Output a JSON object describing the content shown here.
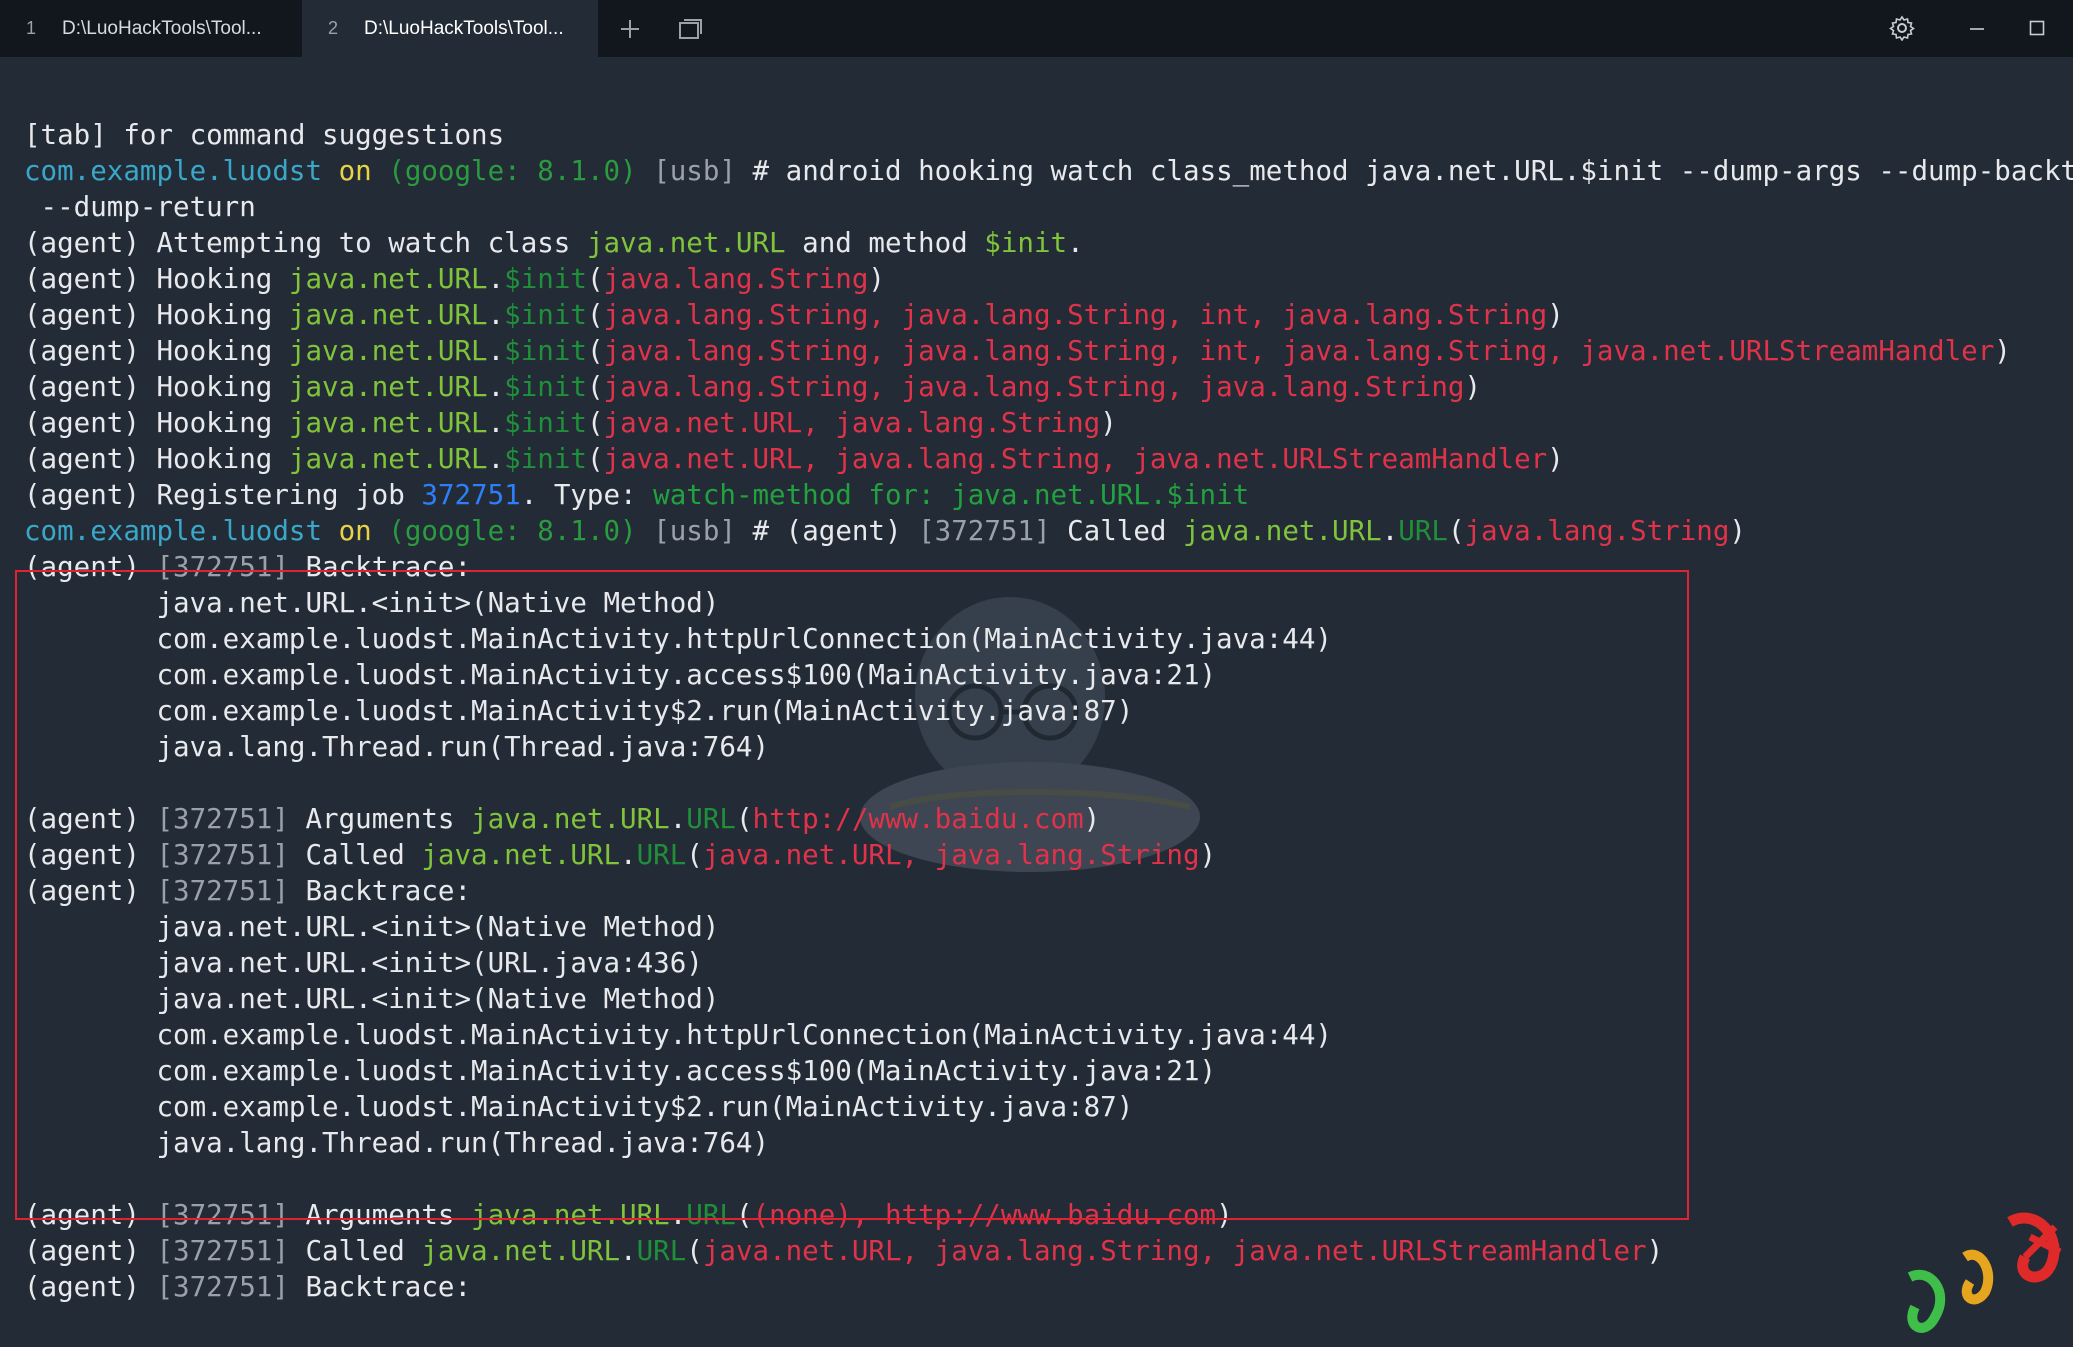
{
  "tabs": [
    {
      "num": "1",
      "title": "D:\\LuoHackTools\\Tool..."
    },
    {
      "num": "2",
      "title": "D:\\LuoHackTools\\Tool..."
    }
  ],
  "icons": {
    "new_tab": "plus-icon",
    "tab_overview": "tabs-icon",
    "settings": "gear-icon",
    "minimize": "minimize-icon",
    "maximize": "maximize-icon"
  },
  "colors": {
    "host": "#3aa7c9",
    "class": "#7fc43a",
    "method": "#1f8f3a",
    "args": "#e0334a",
    "job_id": "#2d7ff9",
    "highlight_border": "#e02232"
  },
  "terminal": {
    "lines": [
      [
        {
          "t": "[tab] for command suggestions"
        }
      ],
      [
        {
          "t": "com.example.luodst",
          "c": "host"
        },
        {
          "t": " "
        },
        {
          "t": "on",
          "c": "on"
        },
        {
          "t": " "
        },
        {
          "t": "(google: 8.1.0)",
          "c": "dev"
        },
        {
          "t": " "
        },
        {
          "t": "[usb]",
          "c": "usb"
        },
        {
          "t": " # android hooking watch class_method java.net.URL.$init --dump-args --dump-backtrace"
        }
      ],
      [
        {
          "t": " --dump-return"
        }
      ],
      [
        {
          "t": "(agent) Attempting to watch class "
        },
        {
          "t": "java.net.URL",
          "c": "cls"
        },
        {
          "t": " and method "
        },
        {
          "t": "$init",
          "c": "cls"
        },
        {
          "t": "."
        }
      ],
      [
        {
          "t": "(agent) Hooking "
        },
        {
          "t": "java.net.URL",
          "c": "cls"
        },
        {
          "t": "."
        },
        {
          "t": "$init",
          "c": "meth"
        },
        {
          "t": "("
        },
        {
          "t": "java.lang.String",
          "c": "arg"
        },
        {
          "t": ")"
        }
      ],
      [
        {
          "t": "(agent) Hooking "
        },
        {
          "t": "java.net.URL",
          "c": "cls"
        },
        {
          "t": "."
        },
        {
          "t": "$init",
          "c": "meth"
        },
        {
          "t": "("
        },
        {
          "t": "java.lang.String, java.lang.String, int, java.lang.String",
          "c": "arg"
        },
        {
          "t": ")"
        }
      ],
      [
        {
          "t": "(agent) Hooking "
        },
        {
          "t": "java.net.URL",
          "c": "cls"
        },
        {
          "t": "."
        },
        {
          "t": "$init",
          "c": "meth"
        },
        {
          "t": "("
        },
        {
          "t": "java.lang.String, java.lang.String, int, java.lang.String, java.net.URLStreamHandler",
          "c": "arg"
        },
        {
          "t": ")"
        }
      ],
      [
        {
          "t": "(agent) Hooking "
        },
        {
          "t": "java.net.URL",
          "c": "cls"
        },
        {
          "t": "."
        },
        {
          "t": "$init",
          "c": "meth"
        },
        {
          "t": "("
        },
        {
          "t": "java.lang.String, java.lang.String, java.lang.String",
          "c": "arg"
        },
        {
          "t": ")"
        }
      ],
      [
        {
          "t": "(agent) Hooking "
        },
        {
          "t": "java.net.URL",
          "c": "cls"
        },
        {
          "t": "."
        },
        {
          "t": "$init",
          "c": "meth"
        },
        {
          "t": "("
        },
        {
          "t": "java.net.URL, java.lang.String",
          "c": "arg"
        },
        {
          "t": ")"
        }
      ],
      [
        {
          "t": "(agent) Hooking "
        },
        {
          "t": "java.net.URL",
          "c": "cls"
        },
        {
          "t": "."
        },
        {
          "t": "$init",
          "c": "meth"
        },
        {
          "t": "("
        },
        {
          "t": "java.net.URL, java.lang.String, java.net.URLStreamHandler",
          "c": "arg"
        },
        {
          "t": ")"
        }
      ],
      [
        {
          "t": "(agent) Registering job "
        },
        {
          "t": "372751",
          "c": "id"
        },
        {
          "t": ". Type: "
        },
        {
          "t": "watch-method for: java.net.URL.$init",
          "c": "watch"
        }
      ],
      [
        {
          "t": "com.example.luodst",
          "c": "host"
        },
        {
          "t": " "
        },
        {
          "t": "on",
          "c": "on"
        },
        {
          "t": " "
        },
        {
          "t": "(google: 8.1.0)",
          "c": "dev"
        },
        {
          "t": " "
        },
        {
          "t": "[usb]",
          "c": "usb"
        },
        {
          "t": " # (agent) "
        },
        {
          "t": "[372751]",
          "c": "job"
        },
        {
          "t": " Called "
        },
        {
          "t": "java.net.URL",
          "c": "cls"
        },
        {
          "t": "."
        },
        {
          "t": "URL",
          "c": "meth"
        },
        {
          "t": "("
        },
        {
          "t": "java.lang.String",
          "c": "arg"
        },
        {
          "t": ")"
        }
      ],
      [
        {
          "t": "(agent) "
        },
        {
          "t": "[372751]",
          "c": "job"
        },
        {
          "t": " Backtrace:"
        }
      ],
      [
        {
          "t": "        java.net.URL.<init>(Native Method)"
        }
      ],
      [
        {
          "t": "        com.example.luodst.MainActivity.httpUrlConnection(MainActivity.java:44)"
        }
      ],
      [
        {
          "t": "        com.example.luodst.MainActivity.access$100(MainActivity.java:21)"
        }
      ],
      [
        {
          "t": "        com.example.luodst.MainActivity$2.run(MainActivity.java:87)"
        }
      ],
      [
        {
          "t": "        java.lang.Thread.run(Thread.java:764)"
        }
      ],
      [
        {
          "t": ""
        }
      ],
      [
        {
          "t": "(agent) "
        },
        {
          "t": "[372751]",
          "c": "job"
        },
        {
          "t": " Arguments "
        },
        {
          "t": "java.net.URL",
          "c": "cls"
        },
        {
          "t": "."
        },
        {
          "t": "URL",
          "c": "meth"
        },
        {
          "t": "("
        },
        {
          "t": "http://www.baidu.com",
          "c": "arg"
        },
        {
          "t": ")"
        }
      ],
      [
        {
          "t": "(agent) "
        },
        {
          "t": "[372751]",
          "c": "job"
        },
        {
          "t": " Called "
        },
        {
          "t": "java.net.URL",
          "c": "cls"
        },
        {
          "t": "."
        },
        {
          "t": "URL",
          "c": "meth"
        },
        {
          "t": "("
        },
        {
          "t": "java.net.URL, java.lang.String",
          "c": "arg"
        },
        {
          "t": ")"
        }
      ],
      [
        {
          "t": "(agent) "
        },
        {
          "t": "[372751]",
          "c": "job"
        },
        {
          "t": " Backtrace:"
        }
      ],
      [
        {
          "t": "        java.net.URL.<init>(Native Method)"
        }
      ],
      [
        {
          "t": "        java.net.URL.<init>(URL.java:436)"
        }
      ],
      [
        {
          "t": "        java.net.URL.<init>(Native Method)"
        }
      ],
      [
        {
          "t": "        com.example.luodst.MainActivity.httpUrlConnection(MainActivity.java:44)"
        }
      ],
      [
        {
          "t": "        com.example.luodst.MainActivity.access$100(MainActivity.java:21)"
        }
      ],
      [
        {
          "t": "        com.example.luodst.MainActivity$2.run(MainActivity.java:87)"
        }
      ],
      [
        {
          "t": "        java.lang.Thread.run(Thread.java:764)"
        }
      ],
      [
        {
          "t": ""
        }
      ],
      [
        {
          "t": "(agent) "
        },
        {
          "t": "[372751]",
          "c": "job"
        },
        {
          "t": " Arguments "
        },
        {
          "t": "java.net.URL",
          "c": "cls"
        },
        {
          "t": "."
        },
        {
          "t": "URL",
          "c": "meth"
        },
        {
          "t": "("
        },
        {
          "t": "(none), http://www.baidu.com",
          "c": "arg"
        },
        {
          "t": ")"
        }
      ],
      [
        {
          "t": "(agent) "
        },
        {
          "t": "[372751]",
          "c": "job"
        },
        {
          "t": " Called "
        },
        {
          "t": "java.net.URL",
          "c": "cls"
        },
        {
          "t": "."
        },
        {
          "t": "URL",
          "c": "meth"
        },
        {
          "t": "("
        },
        {
          "t": "java.net.URL, java.lang.String, java.net.URLStreamHandler",
          "c": "arg"
        },
        {
          "t": ")"
        }
      ],
      [
        {
          "t": "(agent) "
        },
        {
          "t": "[372751]",
          "c": "job"
        },
        {
          "t": " Backtrace:"
        }
      ]
    ]
  }
}
